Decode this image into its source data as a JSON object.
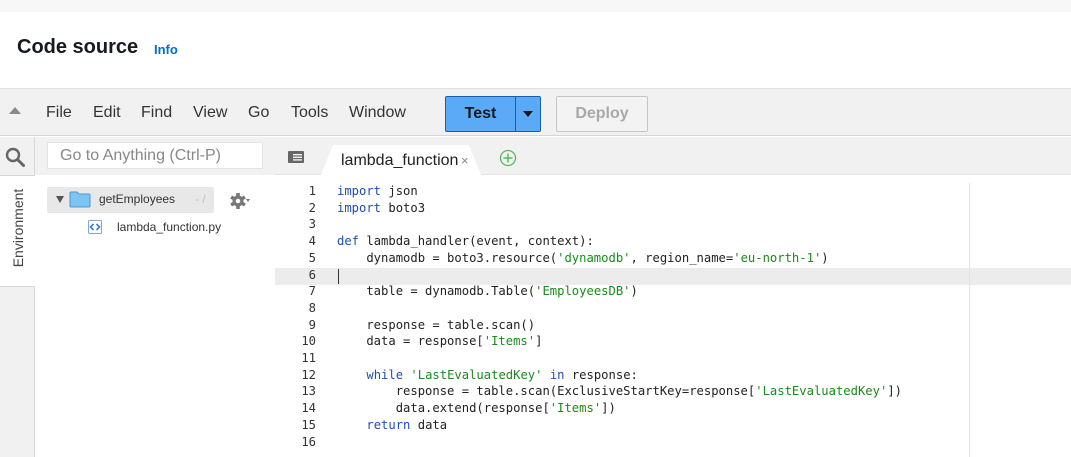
{
  "header": {
    "title": "Code source",
    "info": "Info"
  },
  "menubar": {
    "items": [
      "File",
      "Edit",
      "Find",
      "View",
      "Go",
      "Tools",
      "Window"
    ],
    "test_label": "Test",
    "deploy_label": "Deploy"
  },
  "left_rail": {
    "environment_label": "Environment"
  },
  "goto": {
    "placeholder": "Go to Anything (Ctrl-P)"
  },
  "file_tree": {
    "folder_name": "getEmployees",
    "folder_suffix": "- /",
    "file_name": "lambda_function.py"
  },
  "tabs": {
    "active_label": "lambda_function",
    "close": "×"
  },
  "editor": {
    "lines": [
      {
        "n": "1",
        "tokens": [
          {
            "t": "import",
            "c": "kw"
          },
          {
            "t": " json",
            "c": ""
          }
        ]
      },
      {
        "n": "2",
        "tokens": [
          {
            "t": "import",
            "c": "kw"
          },
          {
            "t": " boto3",
            "c": ""
          }
        ]
      },
      {
        "n": "3",
        "tokens": []
      },
      {
        "n": "4",
        "tokens": [
          {
            "t": "def",
            "c": "kw"
          },
          {
            "t": " lambda_handler(event, context):",
            "c": ""
          }
        ]
      },
      {
        "n": "5",
        "tokens": [
          {
            "t": "    dynamodb = boto3.resource(",
            "c": ""
          },
          {
            "t": "'dynamodb'",
            "c": "str"
          },
          {
            "t": ", region_name=",
            "c": ""
          },
          {
            "t": "'eu-north-1'",
            "c": "str"
          },
          {
            "t": ")",
            "c": ""
          }
        ]
      },
      {
        "n": "6",
        "tokens": []
      },
      {
        "n": "7",
        "tokens": [
          {
            "t": "    table = dynamodb.Table(",
            "c": ""
          },
          {
            "t": "'EmployeesDB'",
            "c": "str"
          },
          {
            "t": ")",
            "c": ""
          }
        ]
      },
      {
        "n": "8",
        "tokens": []
      },
      {
        "n": "9",
        "tokens": [
          {
            "t": "    response = table.scan()",
            "c": ""
          }
        ]
      },
      {
        "n": "10",
        "tokens": [
          {
            "t": "    data = response[",
            "c": ""
          },
          {
            "t": "'Items'",
            "c": "str"
          },
          {
            "t": "]",
            "c": ""
          }
        ]
      },
      {
        "n": "11",
        "tokens": []
      },
      {
        "n": "12",
        "tokens": [
          {
            "t": "    ",
            "c": ""
          },
          {
            "t": "while",
            "c": "kw"
          },
          {
            "t": " ",
            "c": ""
          },
          {
            "t": "'LastEvaluatedKey'",
            "c": "str"
          },
          {
            "t": " ",
            "c": ""
          },
          {
            "t": "in",
            "c": "kw"
          },
          {
            "t": " response:",
            "c": ""
          }
        ]
      },
      {
        "n": "13",
        "tokens": [
          {
            "t": "        response = table.scan(ExclusiveStartKey=response[",
            "c": ""
          },
          {
            "t": "'LastEvaluatedKey'",
            "c": "str"
          },
          {
            "t": "])",
            "c": ""
          }
        ]
      },
      {
        "n": "14",
        "tokens": [
          {
            "t": "        data.extend(response[",
            "c": ""
          },
          {
            "t": "'Items'",
            "c": "str"
          },
          {
            "t": "])",
            "c": ""
          }
        ]
      },
      {
        "n": "15",
        "tokens": [
          {
            "t": "    ",
            "c": ""
          },
          {
            "t": "return",
            "c": "kw"
          },
          {
            "t": " data",
            "c": ""
          }
        ]
      },
      {
        "n": "16",
        "tokens": []
      }
    ]
  }
}
